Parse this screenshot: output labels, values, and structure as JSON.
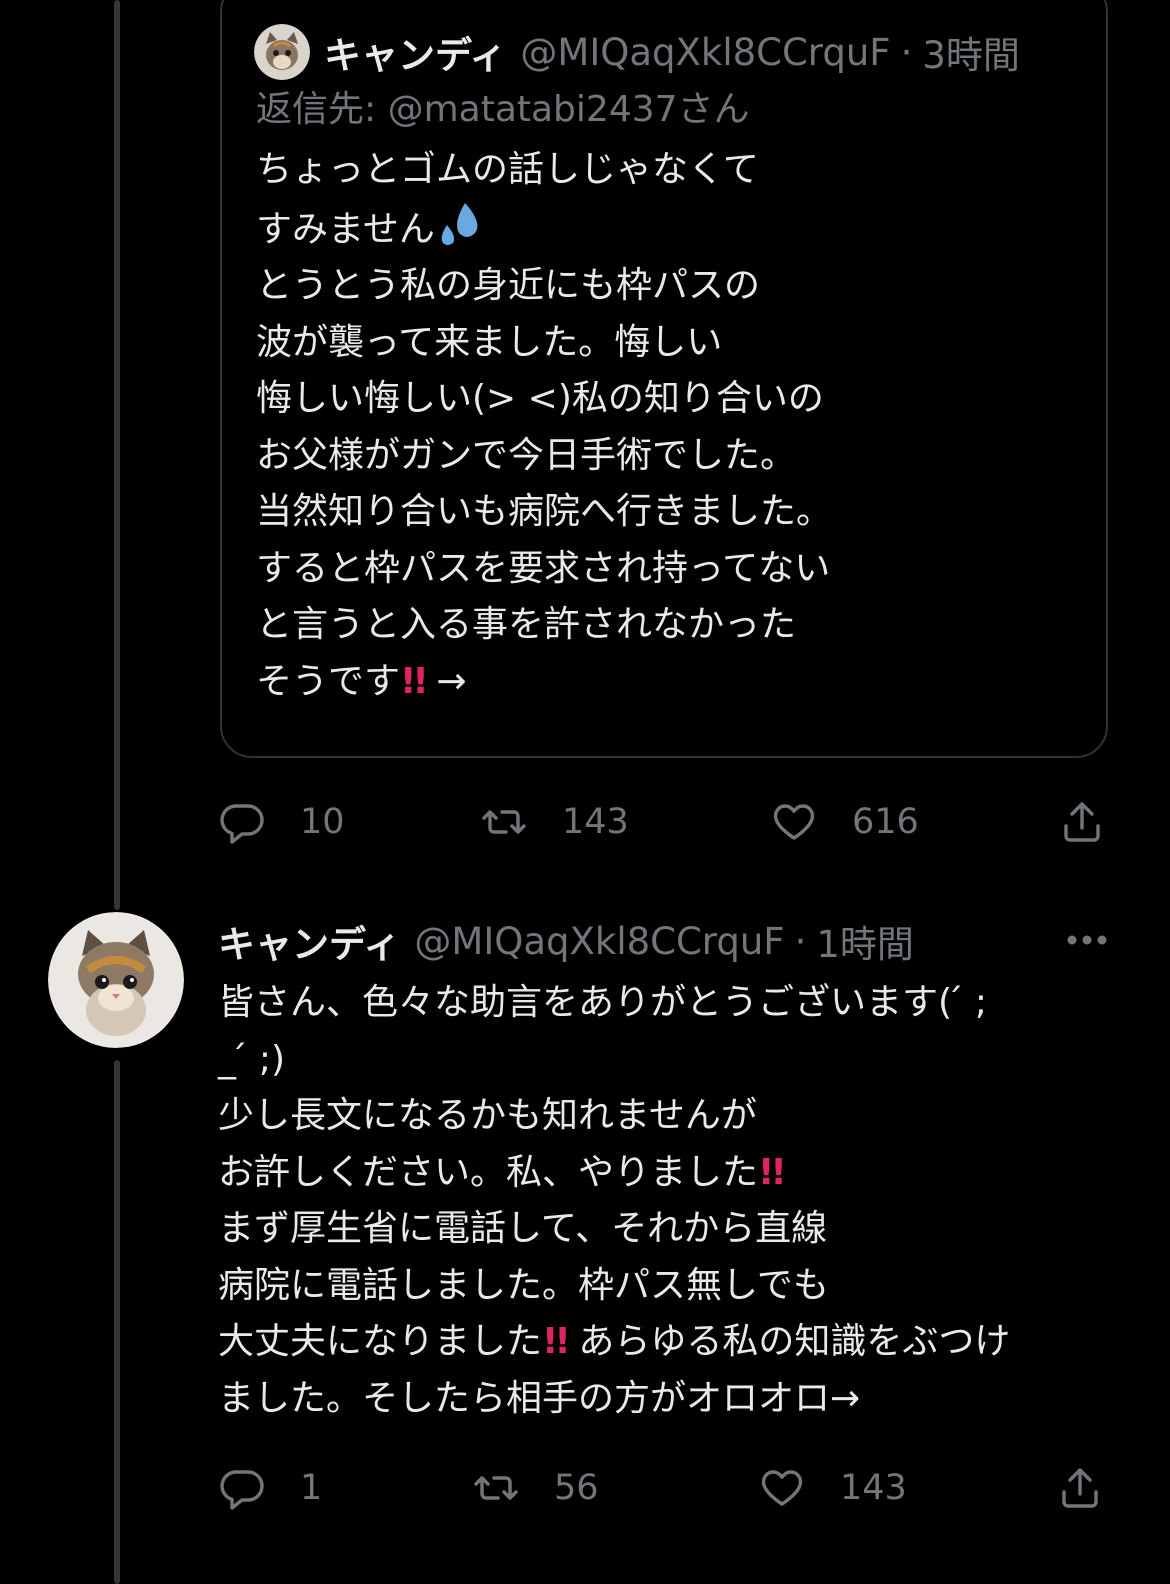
{
  "quoted_tweet": {
    "display_name": "キャンディ",
    "handle": "@MIQaqXkl8CCrquF",
    "separator": "·",
    "time": "3時間",
    "reply_label": "返信先: ",
    "reply_mention": "@matatabi2437さん",
    "body_lines": [
      "ちょっとゴムの話しじゃなくて",
      "すみません",
      "とうとう私の身近にも枠パスの",
      "波が襲って来ました。悔しい",
      "悔しい悔しい(> <)私の知り合いの",
      "お父様がガンで今日手術でした。",
      "当然知り合いも病院へ行きました。",
      "すると枠パスを要求され持ってない",
      "と言うと入る事を許されなかった",
      "そうです"
    ],
    "sweat_emoji": "💦",
    "double_exclaim": "!!",
    "arrow": "→",
    "metrics": {
      "replies": "10",
      "retweets": "143",
      "likes": "616"
    }
  },
  "main_tweet": {
    "display_name": "キャンディ",
    "handle": "@MIQaqXkl8CCrquF",
    "separator": "·",
    "time": "1時間",
    "body_lines": [
      "皆さん、色々な助言をありがとうございます( ́ ;",
      "_ ́ ;)",
      "少し長文になるかも知れませんが",
      "お許しください。私、やりました",
      "まず厚生省に電話して、それから直線",
      "病院に電話しました。枠パス無しでも",
      "大丈夫になりました",
      "あらゆる私の知識をぶつけ",
      "ました。そしたら相手の方がオロオロ→"
    ],
    "double_exclaim": "!!",
    "metrics": {
      "replies": "1",
      "retweets": "56",
      "likes": "143"
    }
  },
  "icons": {
    "reply": "reply-icon",
    "retweet": "retweet-icon",
    "like": "heart-icon",
    "share": "share-icon",
    "more": "more-icon"
  },
  "colors": {
    "background": "#000000",
    "text": "#e7e9ea",
    "secondary": "#71767b",
    "border": "#2f3336",
    "exclaim": "#e0245e"
  }
}
